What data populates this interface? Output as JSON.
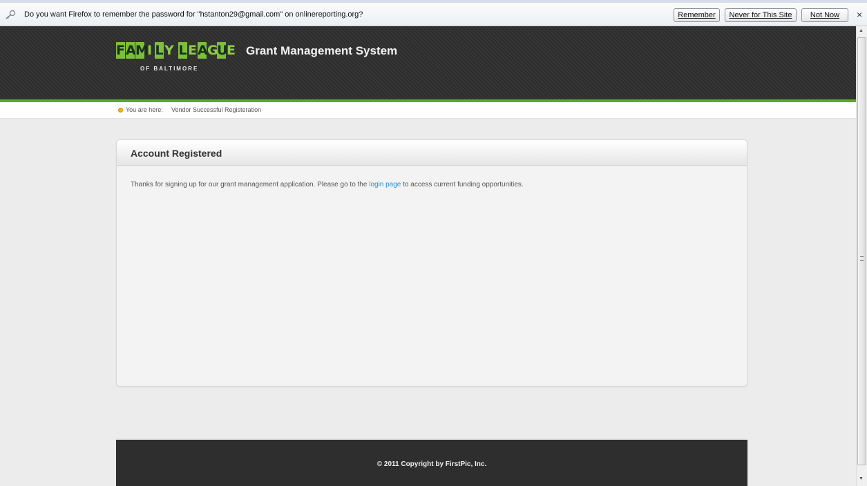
{
  "notification": {
    "message": "Do you want Firefox to remember the password for \"hstanton29@gmail.com\" on onlinereporting.org?",
    "remember_label": "Remember",
    "never_label": "Never for This Site",
    "not_now_label": "Not Now",
    "close_label": "×",
    "icon": "key-icon"
  },
  "header": {
    "logo_word1": [
      "F",
      "A",
      "M",
      "I",
      "L",
      "Y"
    ],
    "logo_word2": [
      "L",
      "E",
      "A",
      "G",
      "U",
      "E"
    ],
    "logo_sub": "OF BALTIMORE",
    "title": "Grant Management System",
    "accent_color": "#5ea82a"
  },
  "breadcrumb": {
    "label": "You are here:",
    "current": "Vendor Successful Registeration"
  },
  "panel": {
    "title": "Account Registered",
    "text_before": "Thanks for signing up for our grant management application. Please go to the ",
    "link_text": "login page",
    "text_after": " to access current funding opportunities."
  },
  "footer": {
    "copyright": "© 2011 Copyright by FirstPic, Inc."
  }
}
